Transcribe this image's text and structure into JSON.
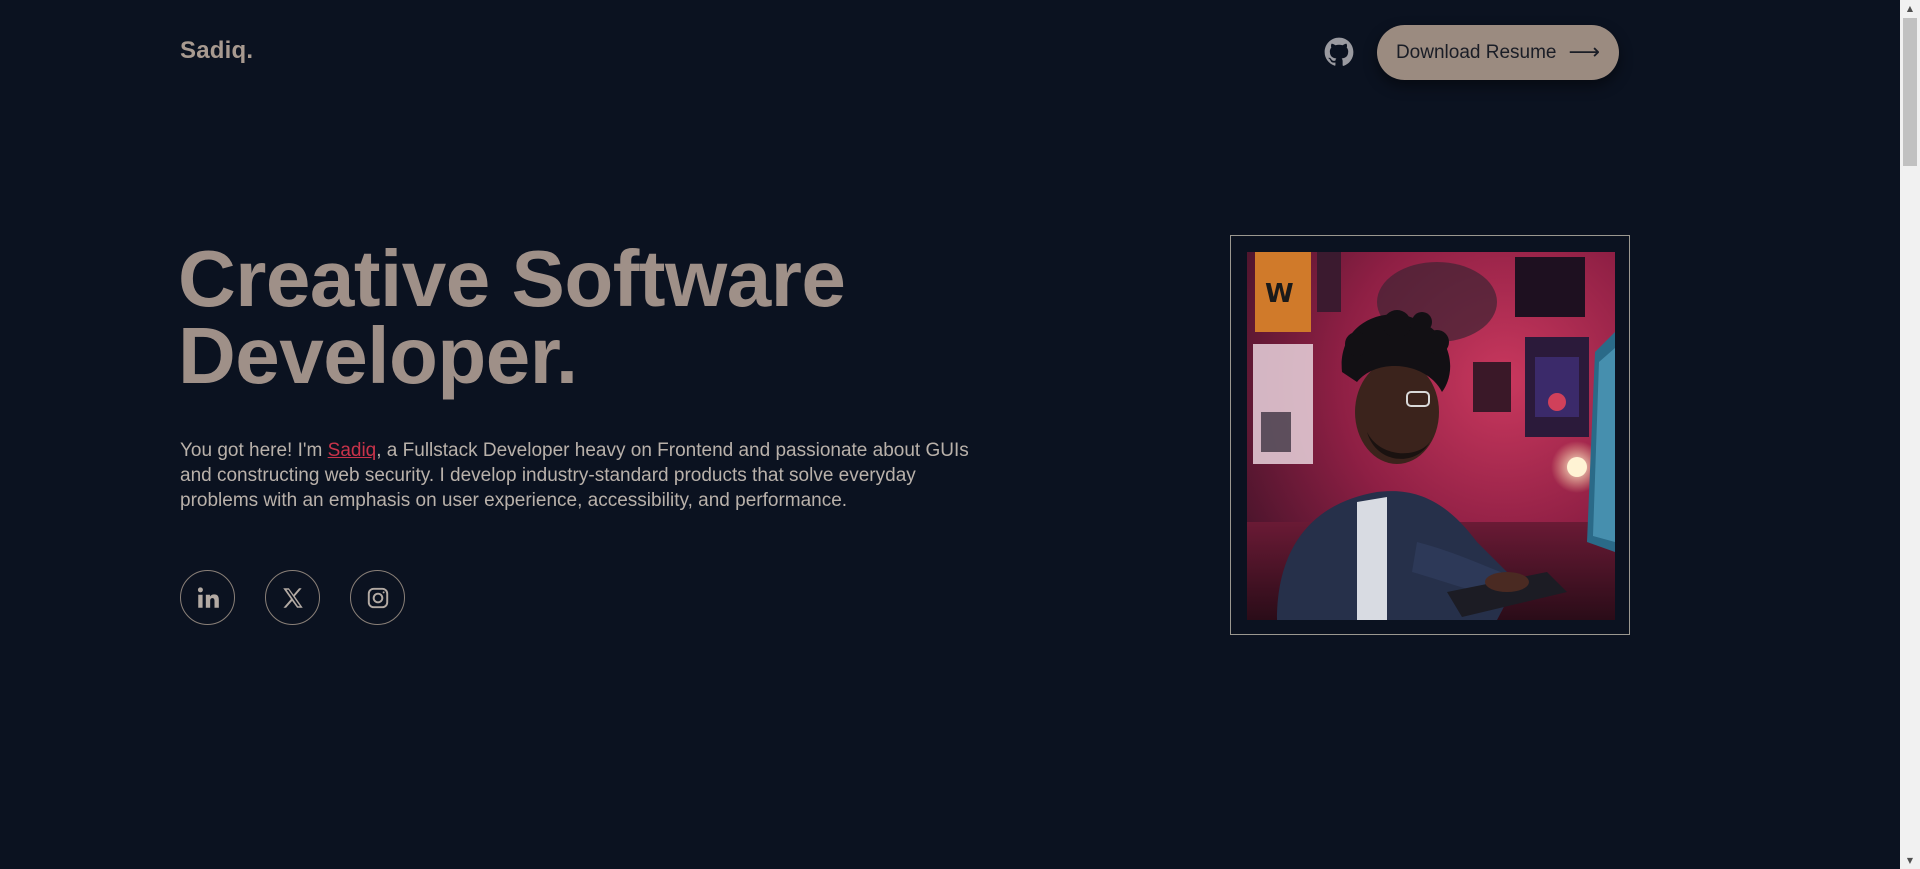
{
  "header": {
    "logo": "Sadiq.",
    "github_icon": "github-icon",
    "resume_button": "Download Resume",
    "resume_arrow": "⟶"
  },
  "hero": {
    "title_line1": "Creative Software",
    "title_line2": "Developer.",
    "intro_before": "You got here! I'm ",
    "intro_name": "Sadiq",
    "intro_after": ", a Fullstack Developer heavy on Frontend and passionate about GUIs and constructing web security. I develop industry-standard products that solve everyday problems with an emphasis on user experience, accessibility, and performance."
  },
  "socials": [
    {
      "icon": "linkedin-icon"
    },
    {
      "icon": "x-icon"
    },
    {
      "icon": "instagram-icon"
    }
  ],
  "colors": {
    "background": "#0b1220",
    "heading": "#9f9088",
    "accent": "#c8334a",
    "button": "#9b8b80"
  }
}
